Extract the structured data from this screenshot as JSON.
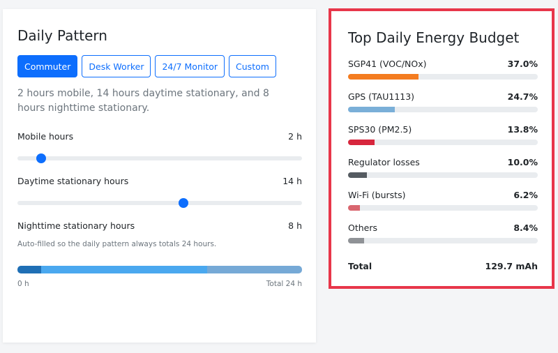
{
  "daily_pattern": {
    "title": "Daily Pattern",
    "presets": [
      {
        "label": "Commuter",
        "active": true
      },
      {
        "label": "Desk Worker",
        "active": false
      },
      {
        "label": "24/7 Monitor",
        "active": false
      },
      {
        "label": "Custom",
        "active": false
      }
    ],
    "description": "2 hours mobile, 14 hours daytime stationary, and 8 hours nighttime stationary.",
    "mobile": {
      "label": "Mobile hours",
      "value_text": "2 h",
      "value": 2,
      "max": 24
    },
    "daytime": {
      "label": "Daytime stationary hours",
      "value_text": "14 h",
      "value": 14,
      "max": 24
    },
    "nighttime": {
      "label": "Nighttime stationary hours",
      "value_text": "8 h",
      "value": 8,
      "note": "Auto-filled so the daily pattern always totals 24 hours."
    },
    "timeline": {
      "start_label": "0 h",
      "end_label": "Total 24 h",
      "segments": [
        {
          "hours": 2,
          "color": "#1f6fb5"
        },
        {
          "hours": 14,
          "color": "#4aa8ef"
        },
        {
          "hours": 8,
          "color": "#76a9d6"
        }
      ]
    }
  },
  "energy_budget": {
    "title": "Top Daily Energy Budget",
    "items": [
      {
        "label": "SGP41 (VOC/NOx)",
        "value_text": "37.0%",
        "percent": 37.0,
        "color": "#f47c20"
      },
      {
        "label": "GPS (TAU1113)",
        "value_text": "24.7%",
        "percent": 24.7,
        "color": "#7aafd8"
      },
      {
        "label": "SPS30 (PM2.5)",
        "value_text": "13.8%",
        "percent": 13.8,
        "color": "#d7263d"
      },
      {
        "label": "Regulator losses",
        "value_text": "10.0%",
        "percent": 10.0,
        "color": "#555b61"
      },
      {
        "label": "Wi-Fi (bursts)",
        "value_text": "6.2%",
        "percent": 6.2,
        "color": "#d9666f"
      },
      {
        "label": "Others",
        "value_text": "8.4%",
        "percent": 8.4,
        "color": "#8f9296"
      }
    ],
    "total_label": "Total",
    "total_value": "129.7 mAh"
  }
}
